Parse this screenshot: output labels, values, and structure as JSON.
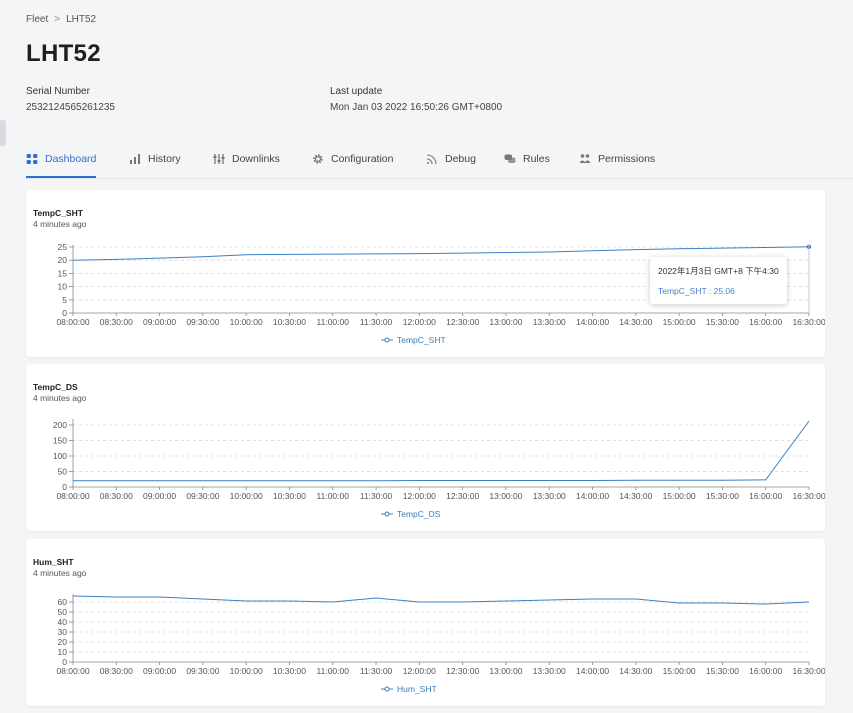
{
  "breadcrumb": {
    "parent": "Fleet",
    "separator": ">",
    "current": "LHT52"
  },
  "page_title": "LHT52",
  "meta": {
    "serial_label": "Serial Number",
    "serial_value": "2532124565261235",
    "update_label": "Last update",
    "update_value": "Mon Jan 03 2022 16:50:26 GMT+0800"
  },
  "tabs": [
    {
      "label": "Dashboard",
      "icon": "grid-icon",
      "active": true
    },
    {
      "label": "History",
      "icon": "bar-chart-icon",
      "active": false
    },
    {
      "label": "Downlinks",
      "icon": "sliders-icon",
      "active": false
    },
    {
      "label": "Configuration",
      "icon": "gear-icon",
      "active": false
    },
    {
      "label": "Debug",
      "icon": "signal-icon",
      "active": false
    },
    {
      "label": "Rules",
      "icon": "chat-icon",
      "active": false
    },
    {
      "label": "Permissions",
      "icon": "users-icon",
      "active": false
    }
  ],
  "colors": {
    "accent": "#2f6fd0",
    "series": "#3a7fc4"
  },
  "tooltip": {
    "time": "2022年1月3日 GMT+8 下午4:30",
    "series": "TempC_SHT",
    "value": "25.06"
  },
  "chart_data": [
    {
      "type": "line",
      "title": "TempC_SHT",
      "subtitle": "4 minutes ago",
      "x": [
        "08:00:00",
        "08:30:00",
        "09:00:00",
        "09:30:00",
        "10:00:00",
        "10:30:00",
        "11:00:00",
        "11:30:00",
        "12:00:00",
        "12:30:00",
        "13:00:00",
        "13:30:00",
        "14:00:00",
        "14:30:00",
        "15:00:00",
        "15:30:00",
        "16:00:00",
        "16:30:00"
      ],
      "series": [
        {
          "name": "TempC_SHT",
          "values": [
            20.0,
            20.3,
            20.8,
            21.3,
            22.1,
            22.2,
            22.3,
            22.4,
            22.5,
            22.7,
            22.9,
            23.1,
            23.6,
            24.0,
            24.3,
            24.6,
            24.8,
            25.06
          ]
        }
      ],
      "yticks": [
        0,
        5,
        10,
        15,
        20,
        25
      ],
      "ylim": [
        0,
        25
      ],
      "grid": true,
      "legend": "bottom"
    },
    {
      "type": "line",
      "title": "TempC_DS",
      "subtitle": "4 minutes ago",
      "x": [
        "08:00:00",
        "08:30:00",
        "09:00:00",
        "09:30:00",
        "10:00:00",
        "10:30:00",
        "11:00:00",
        "11:30:00",
        "12:00:00",
        "12:30:00",
        "13:00:00",
        "13:30:00",
        "14:00:00",
        "14:30:00",
        "15:00:00",
        "15:30:00",
        "16:00:00",
        "16:30:00"
      ],
      "series": [
        {
          "name": "TempC_DS",
          "values": [
            20,
            20,
            20,
            20,
            20,
            20,
            20,
            20,
            21,
            21,
            21,
            21,
            21,
            22,
            22,
            22,
            23,
            213
          ]
        }
      ],
      "yticks": [
        0,
        50,
        100,
        150,
        200
      ],
      "ylim": [
        0,
        213
      ],
      "grid": true,
      "legend": "bottom"
    },
    {
      "type": "line",
      "title": "Hum_SHT",
      "subtitle": "4 minutes ago",
      "x": [
        "08:00:00",
        "08:30:00",
        "09:00:00",
        "09:30:00",
        "10:00:00",
        "10:30:00",
        "11:00:00",
        "11:30:00",
        "12:00:00",
        "12:30:00",
        "13:00:00",
        "13:30:00",
        "14:00:00",
        "14:30:00",
        "15:00:00",
        "15:30:00",
        "16:00:00",
        "16:30:00"
      ],
      "series": [
        {
          "name": "Hum_SHT",
          "values": [
            66,
            65,
            65,
            63,
            61,
            61,
            60,
            64,
            60,
            60,
            61,
            62,
            63,
            63,
            59,
            59,
            58,
            60
          ]
        }
      ],
      "yticks": [
        0,
        10,
        20,
        30,
        40,
        50,
        60
      ],
      "ylim": [
        0,
        66
      ],
      "grid": true,
      "legend": "bottom"
    }
  ]
}
